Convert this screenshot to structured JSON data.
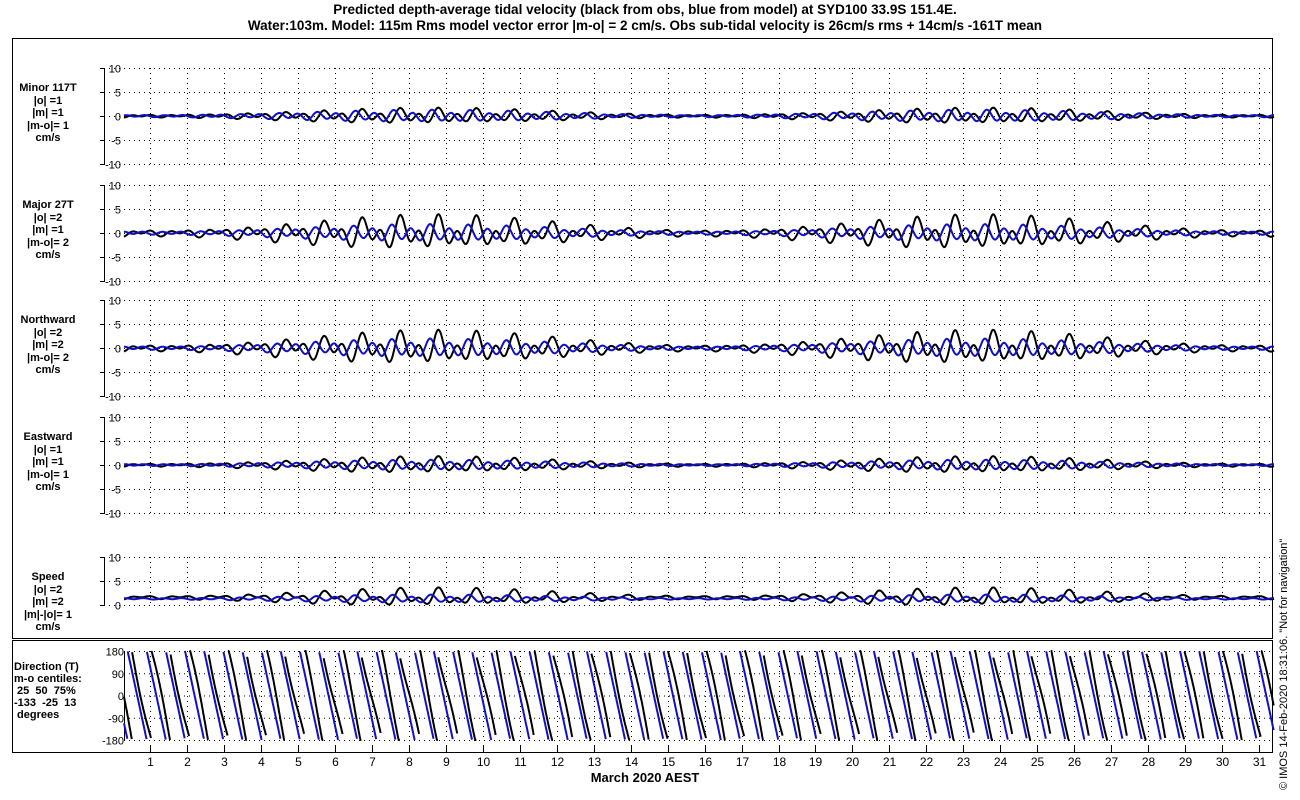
{
  "title": {
    "line1": "Predicted depth-average tidal velocity (black from obs, blue from model) at SYD100 33.9S 151.4E.",
    "line2": "Water:103m. Model: 115m  Rms model vector error |m-o| = 2 cm/s. Obs sub-tidal velocity is 26cm/s rms + 14cm/s -161T mean"
  },
  "footer": "© IMOS 14-Feb-2020 18:31:06. \"Not for navigation\"",
  "colors": {
    "obs": "#000000",
    "model": "#1010c8",
    "grid": "#000000"
  },
  "chart_data": {
    "type": "line",
    "xlabel": "March 2020 AEST",
    "x_ticks": [
      "1",
      "2",
      "3",
      "4",
      "5",
      "6",
      "7",
      "8",
      "9",
      "10",
      "11",
      "12",
      "13",
      "14",
      "15",
      "16",
      "17",
      "18",
      "19",
      "20",
      "21",
      "22",
      "23",
      "24",
      "25",
      "26",
      "27",
      "28",
      "29",
      "30",
      "31"
    ],
    "xlim": [
      0.3,
      31.4
    ],
    "series_legend": [
      {
        "name": "obs",
        "color": "black"
      },
      {
        "name": "model",
        "color": "blue"
      }
    ],
    "panels": [
      {
        "id": "minor",
        "label_lines": [
          "Minor 117T",
          "|o| =1",
          "|m| =1",
          "|m-o|= 1",
          "cm/s"
        ],
        "ylim": [
          -10,
          10
        ],
        "yticks": [
          "10",
          "5",
          "0",
          "-5",
          "-10"
        ],
        "obs": {
          "mean": 0,
          "semidiurnal_amp": 1.0,
          "diurnal_amp": 0.6,
          "phase": 0.0
        },
        "model": {
          "mean": 0,
          "semidiurnal_amp": 0.9,
          "diurnal_amp": 0.3,
          "phase": 0.35
        }
      },
      {
        "id": "major",
        "label_lines": [
          "Major 27T",
          "|o| =2",
          "|m| =1",
          "|m-o|= 2",
          "cm/s"
        ],
        "ylim": [
          -10,
          10
        ],
        "yticks": [
          "10",
          "5",
          "0",
          "-5",
          "-10"
        ],
        "obs": {
          "mean": 0,
          "semidiurnal_amp": 2.0,
          "diurnal_amp": 1.6,
          "phase": 0.0
        },
        "model": {
          "mean": 0,
          "semidiurnal_amp": 1.3,
          "diurnal_amp": 0.4,
          "phase": 0.45
        }
      },
      {
        "id": "northward",
        "label_lines": [
          "Northward",
          "|o| =2",
          "|m| =2",
          "|m-o|= 2",
          "cm/s"
        ],
        "ylim": [
          -10,
          10
        ],
        "yticks": [
          "10",
          "5",
          "0",
          "-5",
          "-10"
        ],
        "obs": {
          "mean": 0,
          "semidiurnal_amp": 2.0,
          "diurnal_amp": 1.5,
          "phase": 0.0
        },
        "model": {
          "mean": 0,
          "semidiurnal_amp": 1.4,
          "diurnal_amp": 0.4,
          "phase": 0.45
        }
      },
      {
        "id": "eastward",
        "label_lines": [
          "Eastward",
          "|o| =1",
          "|m| =1",
          "|m-o|= 1",
          "cm/s"
        ],
        "ylim": [
          -10,
          10
        ],
        "yticks": [
          "10",
          "5",
          "0",
          "-5",
          "-10"
        ],
        "obs": {
          "mean": 0,
          "semidiurnal_amp": 1.0,
          "diurnal_amp": 0.7,
          "phase": 0.0
        },
        "model": {
          "mean": 0,
          "semidiurnal_amp": 0.8,
          "diurnal_amp": 0.2,
          "phase": 0.4
        }
      },
      {
        "id": "speed",
        "label_lines": [
          "Speed",
          "|o| =2",
          "|m| =2",
          "|m|-|o|= 1",
          "cm/s"
        ],
        "ylim": [
          0,
          10
        ],
        "yticks": [
          "10",
          "5",
          "0"
        ],
        "obs": {
          "mean": 1.6,
          "semidiurnal_amp": 0.9,
          "diurnal_amp": 1.0,
          "phase": 0.0
        },
        "model": {
          "mean": 1.3,
          "semidiurnal_amp": 0.6,
          "diurnal_amp": 0.2,
          "phase": 0.4
        }
      }
    ],
    "direction_panel": {
      "label_lines": [
        "Direction (T)",
        "m-o centiles:",
        " 25  50  75%",
        "-133  -25  13",
        " degrees"
      ],
      "ylim": [
        -180,
        180
      ],
      "yticks": [
        "180",
        "90",
        "0",
        "-90",
        "-180"
      ]
    }
  }
}
